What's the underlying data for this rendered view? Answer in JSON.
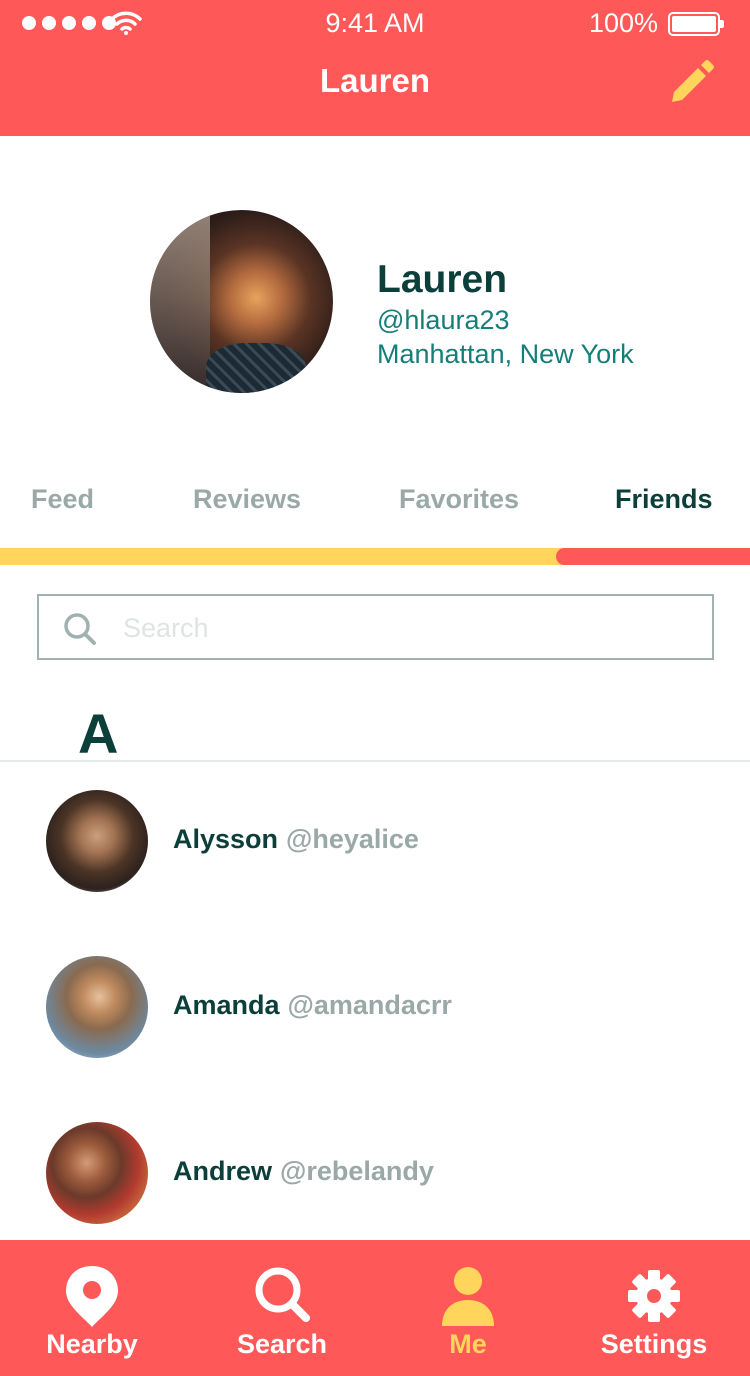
{
  "status_bar": {
    "time": "9:41 AM",
    "battery": "100%"
  },
  "header": {
    "title": "Lauren",
    "edit_icon": "pencil-icon"
  },
  "profile": {
    "name": "Lauren",
    "handle": "@hlaura23",
    "location": "Manhattan, New York"
  },
  "tabs": [
    {
      "label": "Feed",
      "active": false
    },
    {
      "label": "Reviews",
      "active": false
    },
    {
      "label": "Favorites",
      "active": false
    },
    {
      "label": "Friends",
      "active": true
    }
  ],
  "search": {
    "placeholder": "Search",
    "value": ""
  },
  "friends": {
    "section_letter": "A",
    "items": [
      {
        "name": "Alysson",
        "handle": "@heyalice"
      },
      {
        "name": "Amanda",
        "handle": "@amandacrr"
      },
      {
        "name": "Andrew",
        "handle": "@rebelandy"
      }
    ]
  },
  "bottom_nav": {
    "items": [
      {
        "label": "Nearby",
        "icon": "location-pin-icon",
        "active": false
      },
      {
        "label": "Search",
        "icon": "search-icon",
        "active": false
      },
      {
        "label": "Me",
        "icon": "person-icon",
        "active": true
      },
      {
        "label": "Settings",
        "icon": "gear-icon",
        "active": false
      }
    ]
  },
  "colors": {
    "primary": "#FF5858",
    "accent": "#FFD55B",
    "dark_teal": "#0C3E3A",
    "teal": "#157E78",
    "muted": "#9AA9A7"
  }
}
